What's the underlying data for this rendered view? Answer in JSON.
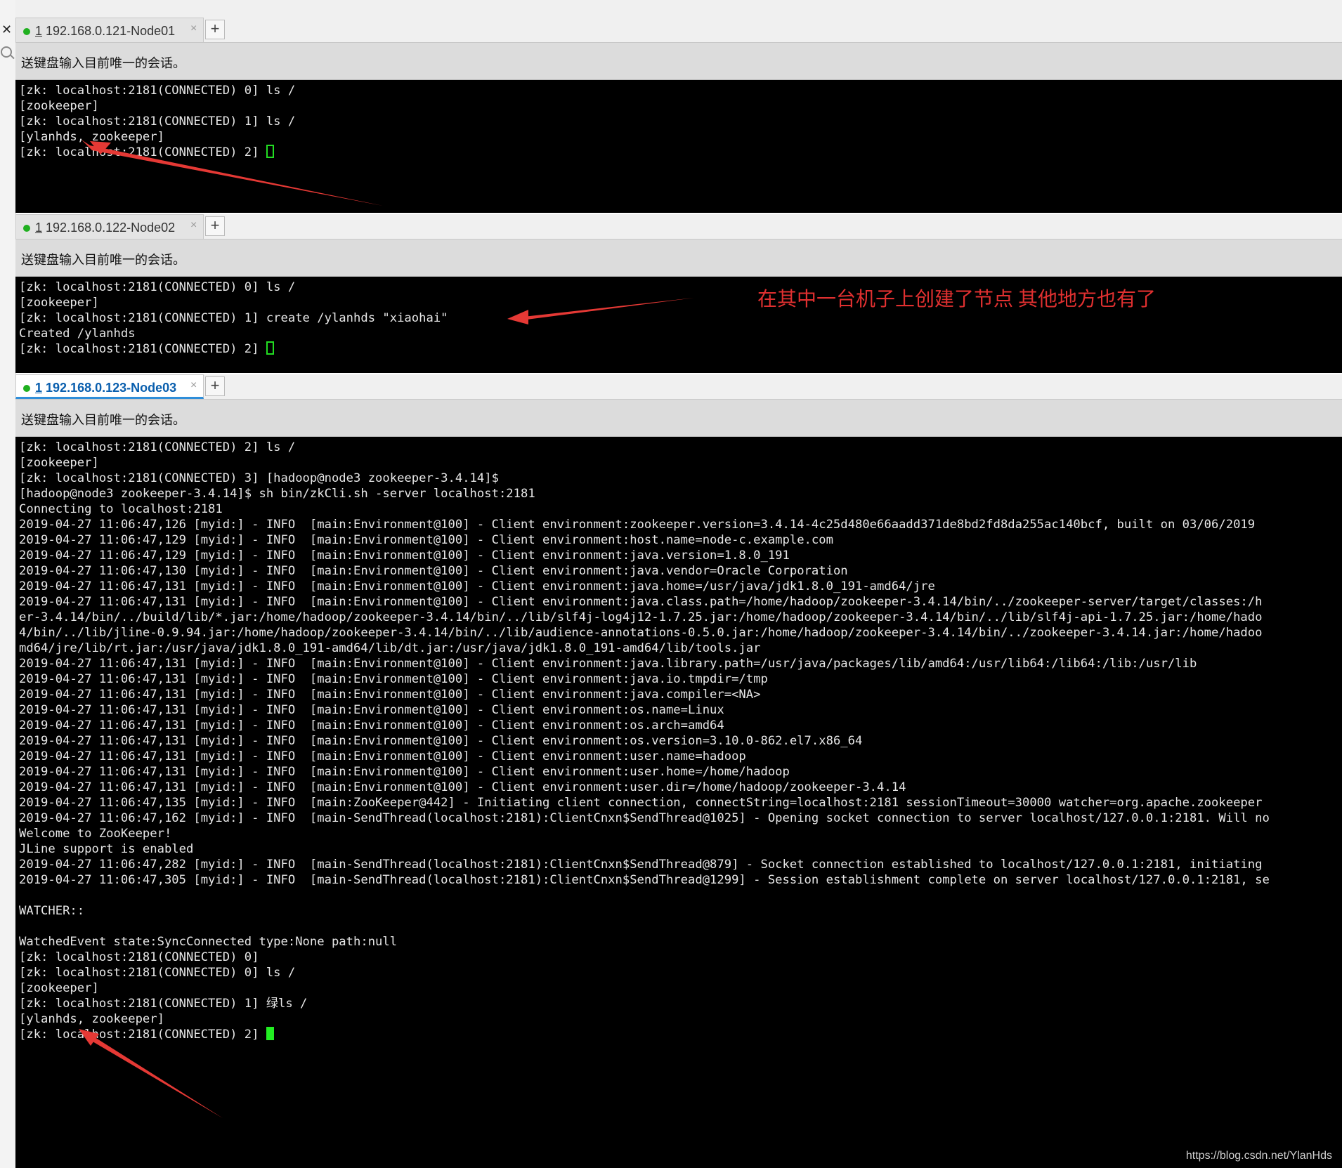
{
  "panes": [
    {
      "tab": {
        "num": "1",
        "title": "192.168.0.121-Node01",
        "close": "×",
        "add": "+"
      },
      "send_bar": "送键盘输入目前唯一的会话。",
      "lines": [
        "[zk: localhost:2181(CONNECTED) 0] ls /",
        "[zookeeper]",
        "[zk: localhost:2181(CONNECTED) 1] ls /",
        "[ylanhds, zookeeper]",
        "[zk: localhost:2181(CONNECTED) 2] "
      ]
    },
    {
      "tab": {
        "num": "1",
        "title": "192.168.0.122-Node02",
        "close": "×",
        "add": "+"
      },
      "send_bar": "送键盘输入目前唯一的会话。",
      "lines": [
        "[zk: localhost:2181(CONNECTED) 0] ls /",
        "[zookeeper]",
        "[zk: localhost:2181(CONNECTED) 1] create /ylanhds \"xiaohai\"",
        "Created /ylanhds",
        "[zk: localhost:2181(CONNECTED) 2] "
      ]
    },
    {
      "tab": {
        "num": "1",
        "title": "192.168.0.123-Node03",
        "close": "×",
        "add": "+"
      },
      "send_bar": "送键盘输入目前唯一的会话。",
      "lines": [
        "[zk: localhost:2181(CONNECTED) 2] ls /",
        "[zookeeper]",
        "[zk: localhost:2181(CONNECTED) 3] [hadoop@node3 zookeeper-3.4.14]$",
        "[hadoop@node3 zookeeper-3.4.14]$ sh bin/zkCli.sh -server localhost:2181",
        "Connecting to localhost:2181",
        "2019-04-27 11:06:47,126 [myid:] - INFO  [main:Environment@100] - Client environment:zookeeper.version=3.4.14-4c25d480e66aadd371de8bd2fd8da255ac140bcf, built on 03/06/2019",
        "2019-04-27 11:06:47,129 [myid:] - INFO  [main:Environment@100] - Client environment:host.name=node-c.example.com",
        "2019-04-27 11:06:47,129 [myid:] - INFO  [main:Environment@100] - Client environment:java.version=1.8.0_191",
        "2019-04-27 11:06:47,130 [myid:] - INFO  [main:Environment@100] - Client environment:java.vendor=Oracle Corporation",
        "2019-04-27 11:06:47,131 [myid:] - INFO  [main:Environment@100] - Client environment:java.home=/usr/java/jdk1.8.0_191-amd64/jre",
        "2019-04-27 11:06:47,131 [myid:] - INFO  [main:Environment@100] - Client environment:java.class.path=/home/hadoop/zookeeper-3.4.14/bin/../zookeeper-server/target/classes:/h",
        "er-3.4.14/bin/../build/lib/*.jar:/home/hadoop/zookeeper-3.4.14/bin/../lib/slf4j-log4j12-1.7.25.jar:/home/hadoop/zookeeper-3.4.14/bin/../lib/slf4j-api-1.7.25.jar:/home/hado",
        "4/bin/../lib/jline-0.9.94.jar:/home/hadoop/zookeeper-3.4.14/bin/../lib/audience-annotations-0.5.0.jar:/home/hadoop/zookeeper-3.4.14/bin/../zookeeper-3.4.14.jar:/home/hadoo",
        "md64/jre/lib/rt.jar:/usr/java/jdk1.8.0_191-amd64/lib/dt.jar:/usr/java/jdk1.8.0_191-amd64/lib/tools.jar",
        "2019-04-27 11:06:47,131 [myid:] - INFO  [main:Environment@100] - Client environment:java.library.path=/usr/java/packages/lib/amd64:/usr/lib64:/lib64:/lib:/usr/lib",
        "2019-04-27 11:06:47,131 [myid:] - INFO  [main:Environment@100] - Client environment:java.io.tmpdir=/tmp",
        "2019-04-27 11:06:47,131 [myid:] - INFO  [main:Environment@100] - Client environment:java.compiler=<NA>",
        "2019-04-27 11:06:47,131 [myid:] - INFO  [main:Environment@100] - Client environment:os.name=Linux",
        "2019-04-27 11:06:47,131 [myid:] - INFO  [main:Environment@100] - Client environment:os.arch=amd64",
        "2019-04-27 11:06:47,131 [myid:] - INFO  [main:Environment@100] - Client environment:os.version=3.10.0-862.el7.x86_64",
        "2019-04-27 11:06:47,131 [myid:] - INFO  [main:Environment@100] - Client environment:user.name=hadoop",
        "2019-04-27 11:06:47,131 [myid:] - INFO  [main:Environment@100] - Client environment:user.home=/home/hadoop",
        "2019-04-27 11:06:47,131 [myid:] - INFO  [main:Environment@100] - Client environment:user.dir=/home/hadoop/zookeeper-3.4.14",
        "2019-04-27 11:06:47,135 [myid:] - INFO  [main:ZooKeeper@442] - Initiating client connection, connectString=localhost:2181 sessionTimeout=30000 watcher=org.apache.zookeeper",
        "2019-04-27 11:06:47,162 [myid:] - INFO  [main-SendThread(localhost:2181):ClientCnxn$SendThread@1025] - Opening socket connection to server localhost/127.0.0.1:2181. Will no",
        "Welcome to ZooKeeper!",
        "JLine support is enabled",
        "2019-04-27 11:06:47,282 [myid:] - INFO  [main-SendThread(localhost:2181):ClientCnxn$SendThread@879] - Socket connection established to localhost/127.0.0.1:2181, initiating",
        "2019-04-27 11:06:47,305 [myid:] - INFO  [main-SendThread(localhost:2181):ClientCnxn$SendThread@1299] - Session establishment complete on server localhost/127.0.0.1:2181, se",
        "",
        "WATCHER::",
        "",
        "WatchedEvent state:SyncConnected type:None path:null",
        "[zk: localhost:2181(CONNECTED) 0]",
        "[zk: localhost:2181(CONNECTED) 0] ls /",
        "[zookeeper]",
        "[zk: localhost:2181(CONNECTED) 1] 绿ls /",
        "[ylanhds, zookeeper]",
        "[zk: localhost:2181(CONNECTED) 2] "
      ]
    }
  ],
  "annotation": "在其中一台机子上创建了节点   其他地方也有了",
  "watermark": "https://blog.csdn.net/YlanHds",
  "colors": {
    "terminal_bg": "#000000",
    "terminal_fg": "#e6e6e6",
    "cursor": "#22ee22",
    "arrow": "#e53935",
    "annotation": "#e03030"
  }
}
